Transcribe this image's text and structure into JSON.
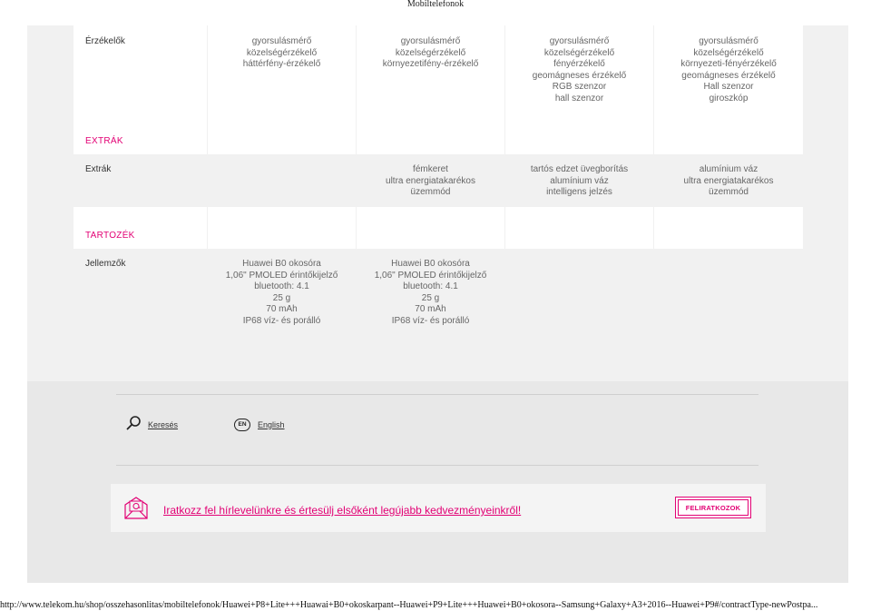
{
  "page_header": "Mobiltelefonok",
  "sensors": {
    "label": "Érzékelők",
    "cols": [
      [
        "gyorsulásmérő",
        "közelségérzékelő",
        "háttérfény-érzékelő"
      ],
      [
        "gyorsulásmérő",
        "közelségérzékelő",
        "környezetifény-érzékelő"
      ],
      [
        "gyorsulásmérő",
        "közelségérzékelő",
        "fényérzékelő",
        "geomágneses érzékelő",
        "RGB szenzor",
        "hall szenzor"
      ],
      [
        "gyorsulásmérő",
        "közelségérzékelő",
        "környezeti-fényérzékelő",
        "geomágneses érzékelő",
        "Hall szenzor",
        "giroszkóp"
      ]
    ]
  },
  "extras": {
    "section_title": "EXTRÁK",
    "label": "Extrák",
    "cols": [
      [],
      [
        "fémkeret",
        "ultra energiatakarékos",
        "üzemmód"
      ],
      [
        "tartós edzet üvegborítás",
        "alumínium váz",
        "intelligens jelzés"
      ],
      [
        "alumínium váz",
        "ultra energiatakarékos",
        "üzemmód"
      ]
    ]
  },
  "accessory": {
    "section_title": "TARTOZÉK",
    "label": "Jellemzők",
    "cols": [
      [
        "Huawei B0 okosóra",
        "1,06\" PMOLED érintőkijelző",
        "bluetooth: 4.1",
        "25 g",
        "70 mAh",
        "IP68 víz- és porálló"
      ],
      [
        "Huawei B0 okosóra",
        "1,06\" PMOLED érintőkijelző",
        "bluetooth: 4.1",
        "25 g",
        "70 mAh",
        "IP68 víz- és porálló"
      ],
      [],
      []
    ]
  },
  "footer": {
    "search_label": "Keresés",
    "lang_badge": "EN",
    "lang_label": "English",
    "newsletter_text": "Iratkozz fel hírlevelünkre és értesülj elsőként legújabb kedvezményeinkről!",
    "subscribe_label": "FELIRATKOZOK"
  },
  "url": "http://www.telekom.hu/shop/osszehasonlitas/mobiltelefonok/Huawei+P8+Lite+++Huawai+B0+okoskarpant--Huawei+P9+Lite+++Huawei+B0+okosora--Samsung+Galaxy+A3+2016--Huawei+P9#/contractType-newPostpa...",
  "colors": {
    "accent": "#e20074",
    "panel": "#f1f1f1",
    "footer": "#e8e8e8"
  }
}
